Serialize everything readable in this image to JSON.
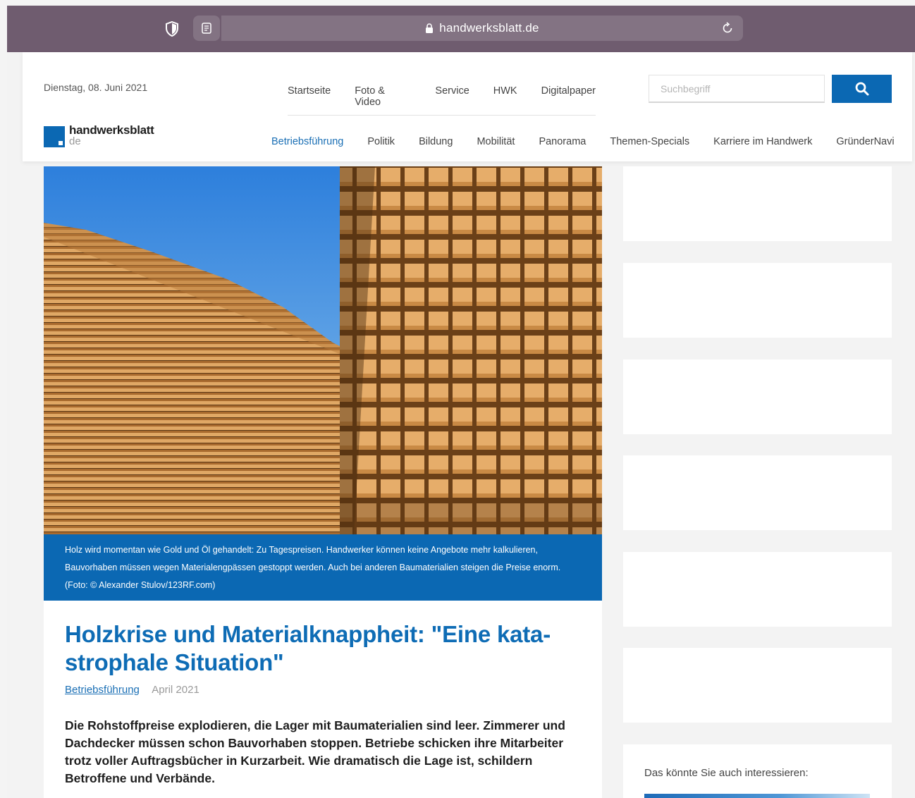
{
  "browser": {
    "url": "handwerksblatt.de"
  },
  "header": {
    "date": "Dienstag, 08. Juni 2021",
    "top_nav": [
      "Startseite",
      "Foto & Video",
      "Service",
      "HWK",
      "Digitalpaper"
    ],
    "search": {
      "placeholder": "Suchbegriff"
    },
    "logo": {
      "name": "handwerksblatt",
      "tld": "de"
    },
    "main_nav": [
      "Betriebsführung",
      "Politik",
      "Bildung",
      "Mobilität",
      "Panorama",
      "Themen-Specials",
      "Karriere im Handwerk",
      "GründerNavi"
    ],
    "active_nav": "Betriebsführung"
  },
  "article": {
    "caption": "Holz wird momentan wie Gold und Öl gehandelt: Zu Tagespreisen. Handwerker können keine Angebote mehr kalkulieren, Bauvorhaben müssen wegen Materialengpässen gestoppt werden. Auch bei anderen Baumaterialien steigen die Preise enorm. (Foto: © Alexander Stulov/123RF.com)",
    "headline": "Holzkrise und Materialknappheit: \"Eine kata­strophale Situation\"",
    "category": "Betriebsführung",
    "date": "April 2021",
    "lead": "Die Rohstoffpreise explodieren, die Lager mit Baumaterialien sind leer. Zimmerer und Dachdecker müssen schon Bauvorhaben stoppen. Betriebe schicken ihre Mitarbeiter trotz voller Auftragsbücher in Kurzarbeit. Wie dramatisch die Lage ist, schildern Betroffene und Verbände."
  },
  "sidebar": {
    "related_title": "Das könnte Sie auch interessieren:"
  },
  "colors": {
    "brand_blue": "#0b68b3",
    "toolbar": "#6f5c6f",
    "sky": "#3d8fe6",
    "wood": "#d89a55"
  }
}
